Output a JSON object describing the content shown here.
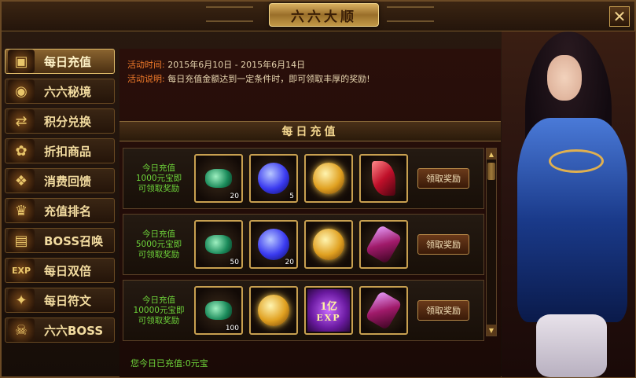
{
  "window": {
    "title": "六六大顺",
    "close_icon": "close-icon"
  },
  "sidebar": {
    "items": [
      {
        "label": "每日充值",
        "icon": "treasure-chest-icon",
        "active": true
      },
      {
        "label": "六六秘境",
        "icon": "portal-icon",
        "active": false
      },
      {
        "label": "积分兑换",
        "icon": "exchange-icon",
        "active": false
      },
      {
        "label": "折扣商品",
        "icon": "sale-bag-icon",
        "active": false
      },
      {
        "label": "消费回馈",
        "icon": "gift-box-icon",
        "active": false
      },
      {
        "label": "充值排名",
        "icon": "trophy-icon",
        "active": false
      },
      {
        "label": "BOSS召唤",
        "icon": "chest-icon",
        "active": false
      },
      {
        "label": "每日双倍",
        "icon": "exp-icon",
        "active": false
      },
      {
        "label": "每日符文",
        "icon": "rune-icon",
        "active": false
      },
      {
        "label": "六六BOSS",
        "icon": "boss-icon",
        "active": false
      }
    ]
  },
  "info": {
    "time_label": "活动时间:",
    "time_value": "2015年6月10日 - 2015年6月14日",
    "desc_label": "活动说明:",
    "desc_value": "每日充值金额达到一定条件时，即可领取丰厚的奖励!"
  },
  "section": {
    "title": "每日充值"
  },
  "tiers": [
    {
      "line1": "今日充值",
      "line2": "1000元宝即",
      "line3": "可领取奖励",
      "rewards": [
        {
          "icon": "green-gems-icon",
          "count": "20"
        },
        {
          "icon": "blue-orb-icon",
          "count": "5"
        },
        {
          "icon": "gold-orb-icon",
          "count": ""
        },
        {
          "icon": "red-feather-icon",
          "count": ""
        }
      ],
      "button": "领取奖励"
    },
    {
      "line1": "今日充值",
      "line2": "5000元宝即",
      "line3": "可领取奖励",
      "rewards": [
        {
          "icon": "green-gems-icon",
          "count": "50"
        },
        {
          "icon": "blue-orb-icon",
          "count": "20"
        },
        {
          "icon": "gold-orb-icon",
          "count": ""
        },
        {
          "icon": "purple-crystal-icon",
          "count": ""
        }
      ],
      "button": "领取奖励"
    },
    {
      "line1": "今日充值",
      "line2": "10000元宝即",
      "line3": "可领取奖励",
      "rewards": [
        {
          "icon": "green-gems-icon",
          "count": "100"
        },
        {
          "icon": "gold-orb-icon",
          "count": ""
        },
        {
          "icon": "exp-scroll-icon",
          "count": "",
          "exp_big": "1亿",
          "exp_small": "EXP"
        },
        {
          "icon": "purple-crystal-icon",
          "count": ""
        }
      ],
      "button": "领取奖励"
    }
  ],
  "footer": {
    "today_recharge": "您今日已充值:0元宝"
  },
  "colors": {
    "accent_gold": "#e0bc6a",
    "green_text": "#6ed43a",
    "label_orange": "#f07a2a"
  }
}
